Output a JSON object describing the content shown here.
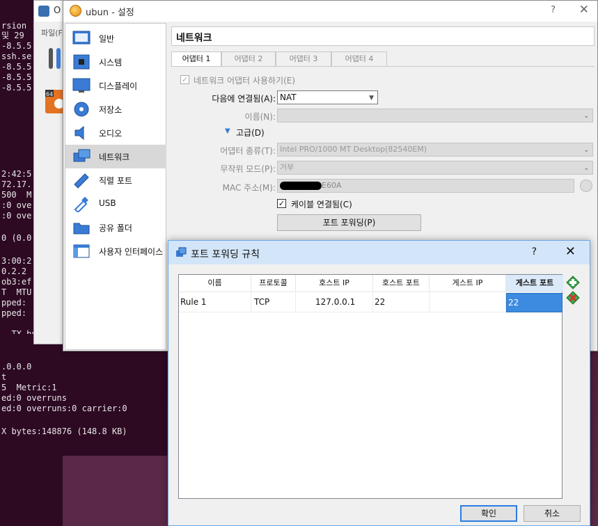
{
  "terminal": {
    "lines": [
      "rsion (",
      "및 29",
      "-8.5.5",
      "ssh.se",
      "-8.5.5",
      "-8.5.5",
      "-8.5.5",
      "2:42:5",
      "72.17.",
      "500  M",
      ":0 ove",
      ":0 ove",
      "0 (0.0",
      "3:00:2",
      "0.2.2",
      "ob3:ef",
      "T  MTU",
      "pped:",
      "pped:",
      "  TX by"
    ],
    "lower_lines": [
      ".0.0.0",
      "t",
      "5  Metric:1",
      "ed:0 overruns",
      "ed:0 overruns:0 carrier:0",
      "",
      "X bytes:148876 (148.8 KB)"
    ]
  },
  "vbox_main": {
    "title": "O",
    "menu": "파일(F"
  },
  "settings": {
    "title": "ubun - 설정",
    "help": "?",
    "close": "✕",
    "sidebar": [
      {
        "label": "일반",
        "icon": "general-icon"
      },
      {
        "label": "시스템",
        "icon": "system-icon"
      },
      {
        "label": "디스플레이",
        "icon": "display-icon"
      },
      {
        "label": "저장소",
        "icon": "storage-icon"
      },
      {
        "label": "오디오",
        "icon": "audio-icon"
      },
      {
        "label": "네트워크",
        "icon": "network-icon",
        "selected": true
      },
      {
        "label": "직렬 포트",
        "icon": "serial-port-icon"
      },
      {
        "label": "USB",
        "icon": "usb-icon"
      },
      {
        "label": "공유 폴더",
        "icon": "shared-folder-icon"
      },
      {
        "label": "사용자 인터페이스",
        "icon": "user-interface-icon"
      }
    ],
    "panel_title": "네트워크",
    "tabs": [
      "어댑터 1",
      "어댑터 2",
      "어댑터 3",
      "어댑터 4"
    ],
    "enable_adapter": "네트워크 어댑터 사용하기(E)",
    "attached_label": "다음에 연결됨(A):",
    "attached_value": "NAT",
    "name_label": "이름(N):",
    "advanced": "고급(D)",
    "adapter_type_label": "어댑터 종류(T):",
    "adapter_type_value": "Intel PRO/1000 MT Desktop(82540EM)",
    "promisc_label": "무작위 모드(P):",
    "promisc_value": "거부",
    "mac_label": "MAC 주소(M):",
    "mac_value": "E60A",
    "cable_connected": "케이블 연결됨(C)",
    "port_forwarding_button": "포트 포워딩(P)"
  },
  "port_forwarding": {
    "title": "포트 포워딩 규칙",
    "help": "?",
    "close": "✕",
    "columns": [
      "이름",
      "프로토콜",
      "호스트 IP",
      "호스트 포트",
      "게스트 IP",
      "게스트 포트"
    ],
    "rows": [
      {
        "name": "Rule 1",
        "protocol": "TCP",
        "host_ip": "127.0.0.1",
        "host_port": "22",
        "guest_ip": "",
        "guest_port": "22"
      }
    ],
    "ok": "확인",
    "cancel": "취소"
  }
}
